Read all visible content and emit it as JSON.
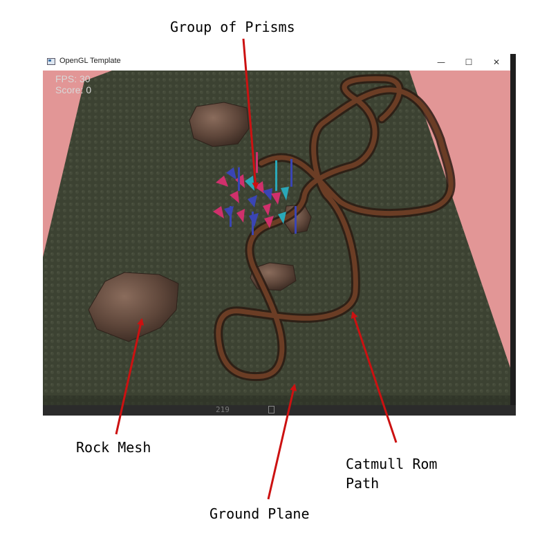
{
  "annotations": {
    "prisms": "Group of Prisms",
    "rock": "Rock Mesh",
    "catmull_line1": "Catmull Rom",
    "catmull_line2": "Path",
    "ground": "Ground Plane"
  },
  "window": {
    "title": "OpenGL Template",
    "minimize_glyph": "—",
    "maximize_glyph": "☐",
    "close_glyph": "✕"
  },
  "hud": {
    "fps_label": "FPS: 30",
    "score_label": "Score: 0"
  },
  "editor": {
    "line_number": "219"
  },
  "colors": {
    "background": "#e29696",
    "ground": "#3c4232",
    "path": "#6b3d25",
    "rock": "#6e5448",
    "prism_pink": "#d0306c",
    "prism_blue": "#3a45b4",
    "prism_cyan": "#2aa8b8",
    "arrow": "#cc1111"
  }
}
